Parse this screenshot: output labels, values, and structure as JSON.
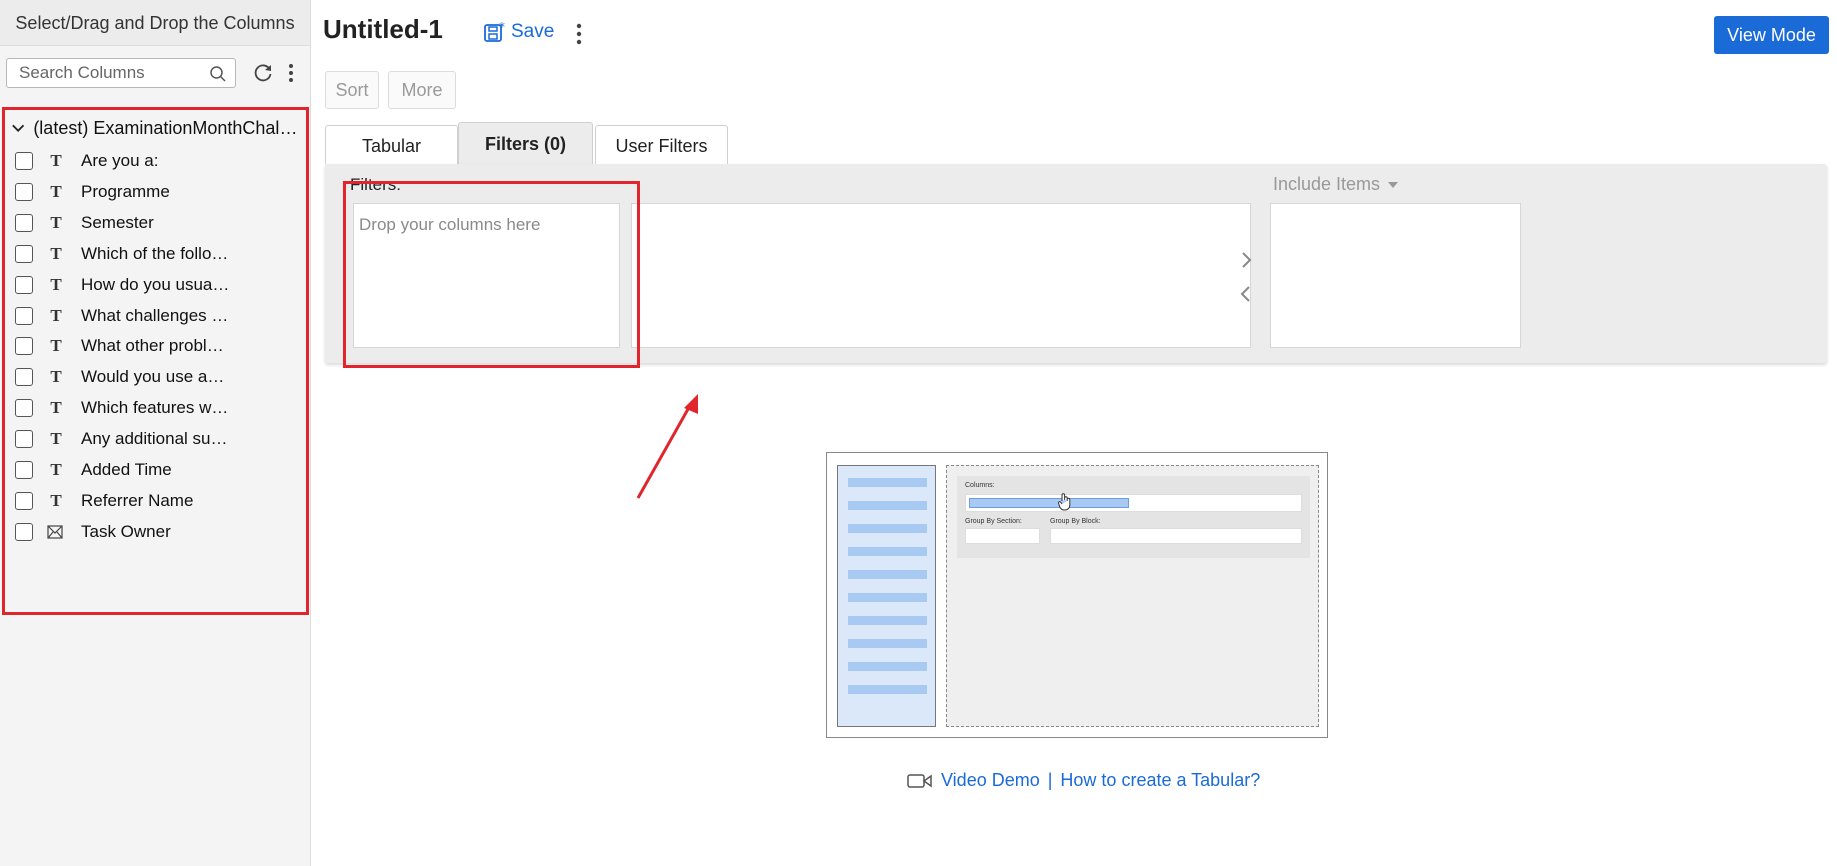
{
  "sidebar": {
    "title": "Select/Drag and Drop the Columns",
    "search_placeholder": "Search Columns",
    "table_name": "(latest) ExaminationMonthChallenges",
    "columns": [
      {
        "label": "Are you a:",
        "type": "text"
      },
      {
        "label": "Programme",
        "type": "text"
      },
      {
        "label": "Semester",
        "type": "text"
      },
      {
        "label": "Which of the following problems do you usually face?",
        "type": "text"
      },
      {
        "label": "How do you usually revise?",
        "type": "text"
      },
      {
        "label": "What challenges do you face?",
        "type": "text"
      },
      {
        "label": "What other problems do you face?",
        "type": "text"
      },
      {
        "label": "Would you use an app?",
        "type": "text"
      },
      {
        "label": "Which features would you like?",
        "type": "text"
      },
      {
        "label": "Any additional suggestions?",
        "type": "text"
      },
      {
        "label": "Added Time",
        "type": "text"
      },
      {
        "label": "Referrer Name",
        "type": "text"
      },
      {
        "label": "Task Owner",
        "type": "email"
      }
    ]
  },
  "header": {
    "title": "Untitled-1",
    "save_label": "Save",
    "view_mode_label": "View Mode"
  },
  "toolbar": {
    "sort_label": "Sort",
    "more_label": "More"
  },
  "tabs": [
    {
      "label": "Tabular"
    },
    {
      "label": "Filters  (0)"
    },
    {
      "label": "User Filters"
    }
  ],
  "filters": {
    "label": "Filters:",
    "drop_placeholder": "Drop your columns here",
    "include_items_label": "Include Items"
  },
  "illustration": {
    "columns_label": "Columns:",
    "group_section_label": "Group By Section:",
    "group_block_label": "Group By Block:"
  },
  "help": {
    "video_demo": "Video Demo",
    "separator": "|",
    "how_to": "How to create a Tabular?"
  },
  "colors": {
    "accent": "#1a6ad8",
    "highlight": "#e0262c"
  }
}
